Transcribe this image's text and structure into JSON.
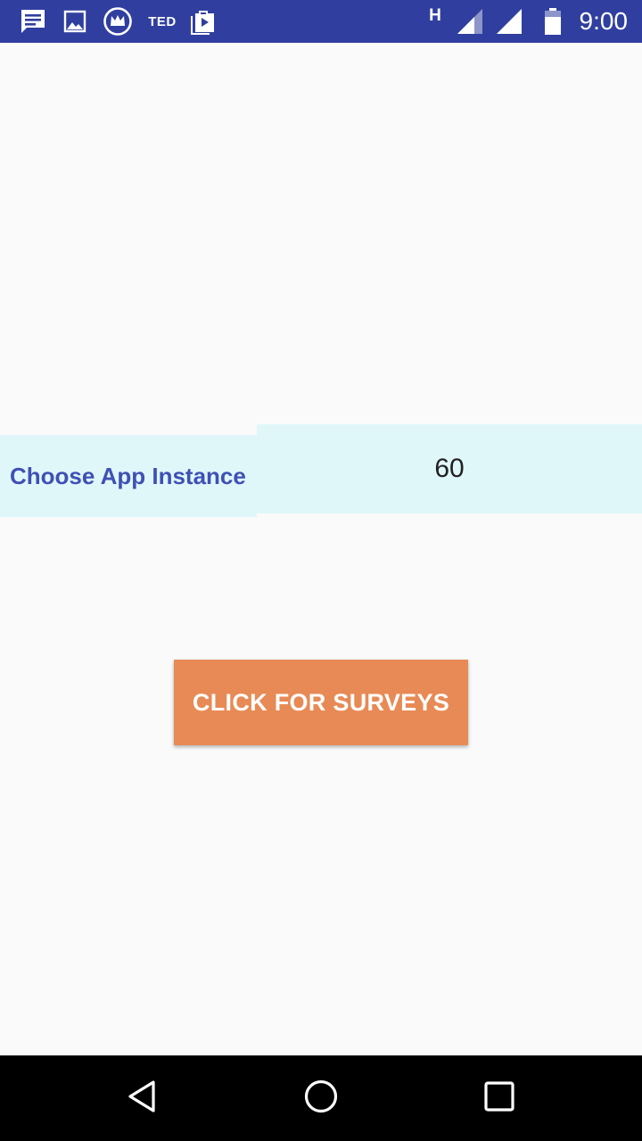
{
  "status_bar": {
    "time": "9:00",
    "ted_label": "TED",
    "network_type": "H",
    "color": "#303f9f",
    "left_icons": [
      "message-icon",
      "image-icon",
      "crown-app-icon",
      "ted-icon",
      "play-store-icon"
    ],
    "right_icons": [
      "signal-icon",
      "signal-icon",
      "battery-icon"
    ]
  },
  "instance_row": {
    "label": "Choose App Instance",
    "selected_value": "60",
    "label_color": "#3f51b5",
    "background": "#e0f7fa"
  },
  "survey_button": {
    "label": "CLICK FOR SURVEYS",
    "color": "#e88a55"
  },
  "nav_bar": {
    "buttons": [
      "back-icon",
      "home-icon",
      "recents-icon"
    ]
  }
}
